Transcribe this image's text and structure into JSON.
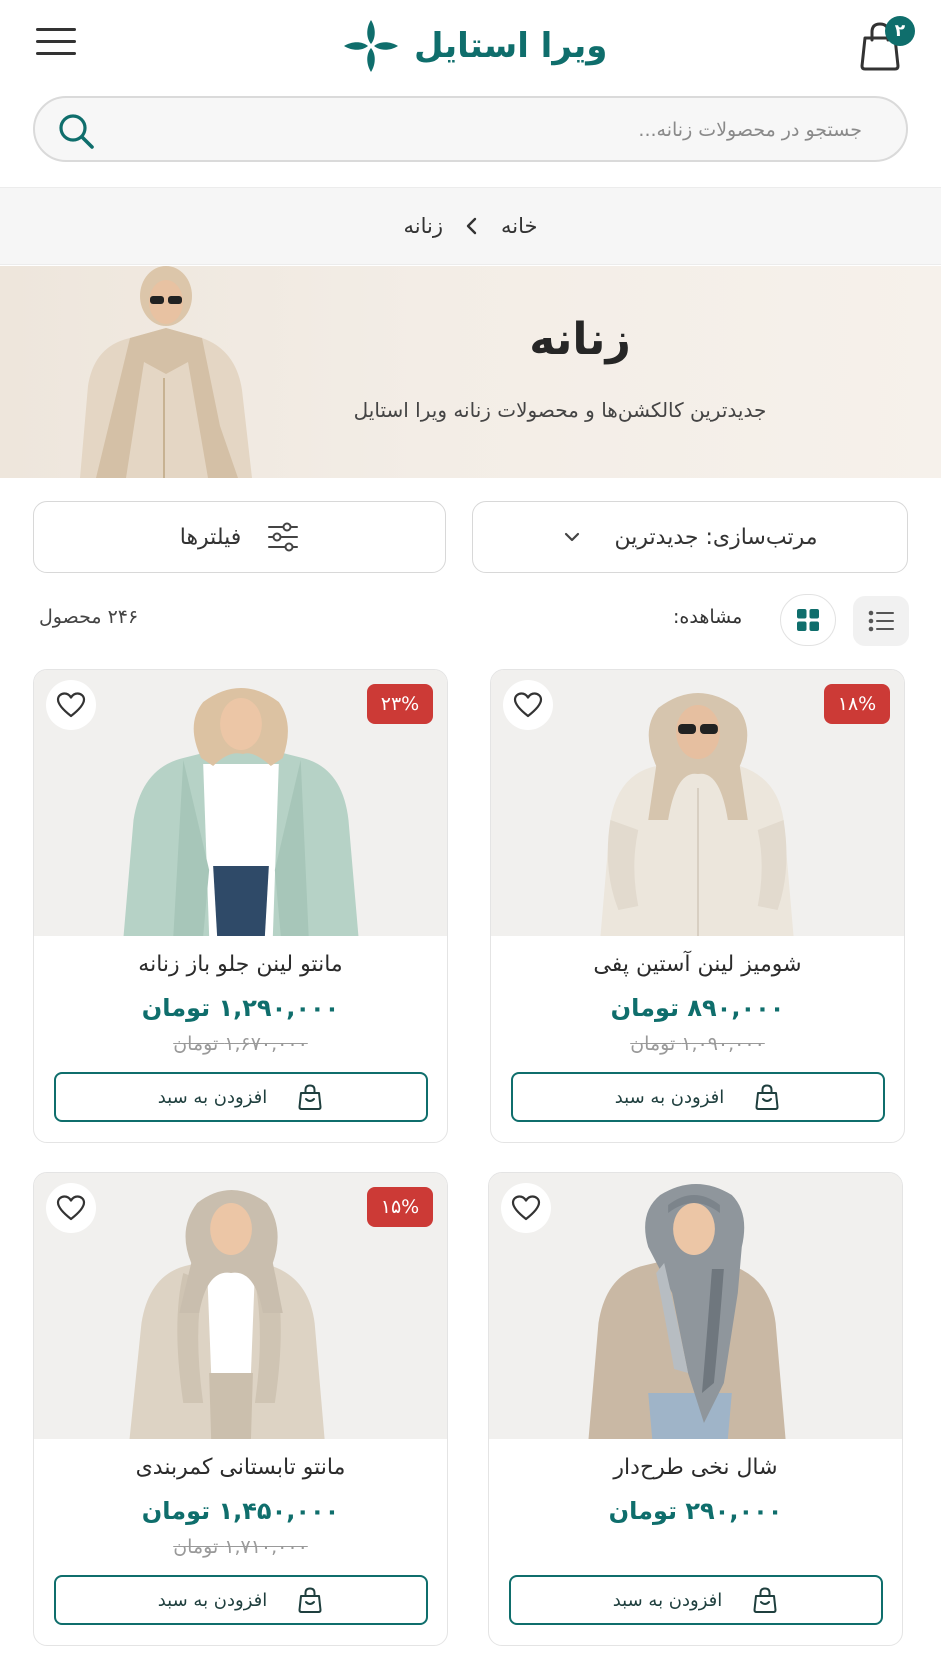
{
  "header": {
    "brand_name": "ویرا استایل",
    "cart_count": "۲",
    "brand_color": "#0f6e6c"
  },
  "search": {
    "placeholder": "جستجو در محصولات زنانه..."
  },
  "breadcrumb": {
    "home": "خانه",
    "current": "زنانه"
  },
  "hero": {
    "title": "زنانه",
    "subtitle": "جدیدترین کالکشن‌ها و محصولات زنانه ویرا استایل"
  },
  "controls": {
    "sort_label": "مرتب‌سازی: جدیدترین",
    "filter_label": "فیلترها",
    "view_label": "مشاهده:",
    "product_count": "۲۴۶ محصول",
    "active_view": "grid"
  },
  "products": [
    {
      "name": "شومیز لینن آستین پفی",
      "price": "۸۹۰,۰۰۰ تومان",
      "old_price": "۱,۰۹۰,۰۰۰ تومان",
      "discount": "۱۸%",
      "add_label": "افزودن به سبد"
    },
    {
      "name": "مانتو لینن جلو باز زنانه",
      "price": "۱,۲۹۰,۰۰۰ تومان",
      "old_price": "۱,۶۷۰,۰۰۰ تومان",
      "discount": "۲۳%",
      "add_label": "افزودن به سبد"
    },
    {
      "name": "شال نخی طرح‌دار",
      "price": "۲۹۰,۰۰۰ تومان",
      "old_price": "",
      "discount": "",
      "add_label": "افزودن به سبد"
    },
    {
      "name": "مانتو تابستانی کمربندی",
      "price": "۱,۴۵۰,۰۰۰ تومان",
      "old_price": "۱,۷۱۰,۰۰۰ تومان",
      "discount": "۱۵%",
      "add_label": "افزودن به سبد"
    }
  ],
  "colors": {
    "accent": "#0f6e6c",
    "sale_badge": "#cc3a36"
  }
}
